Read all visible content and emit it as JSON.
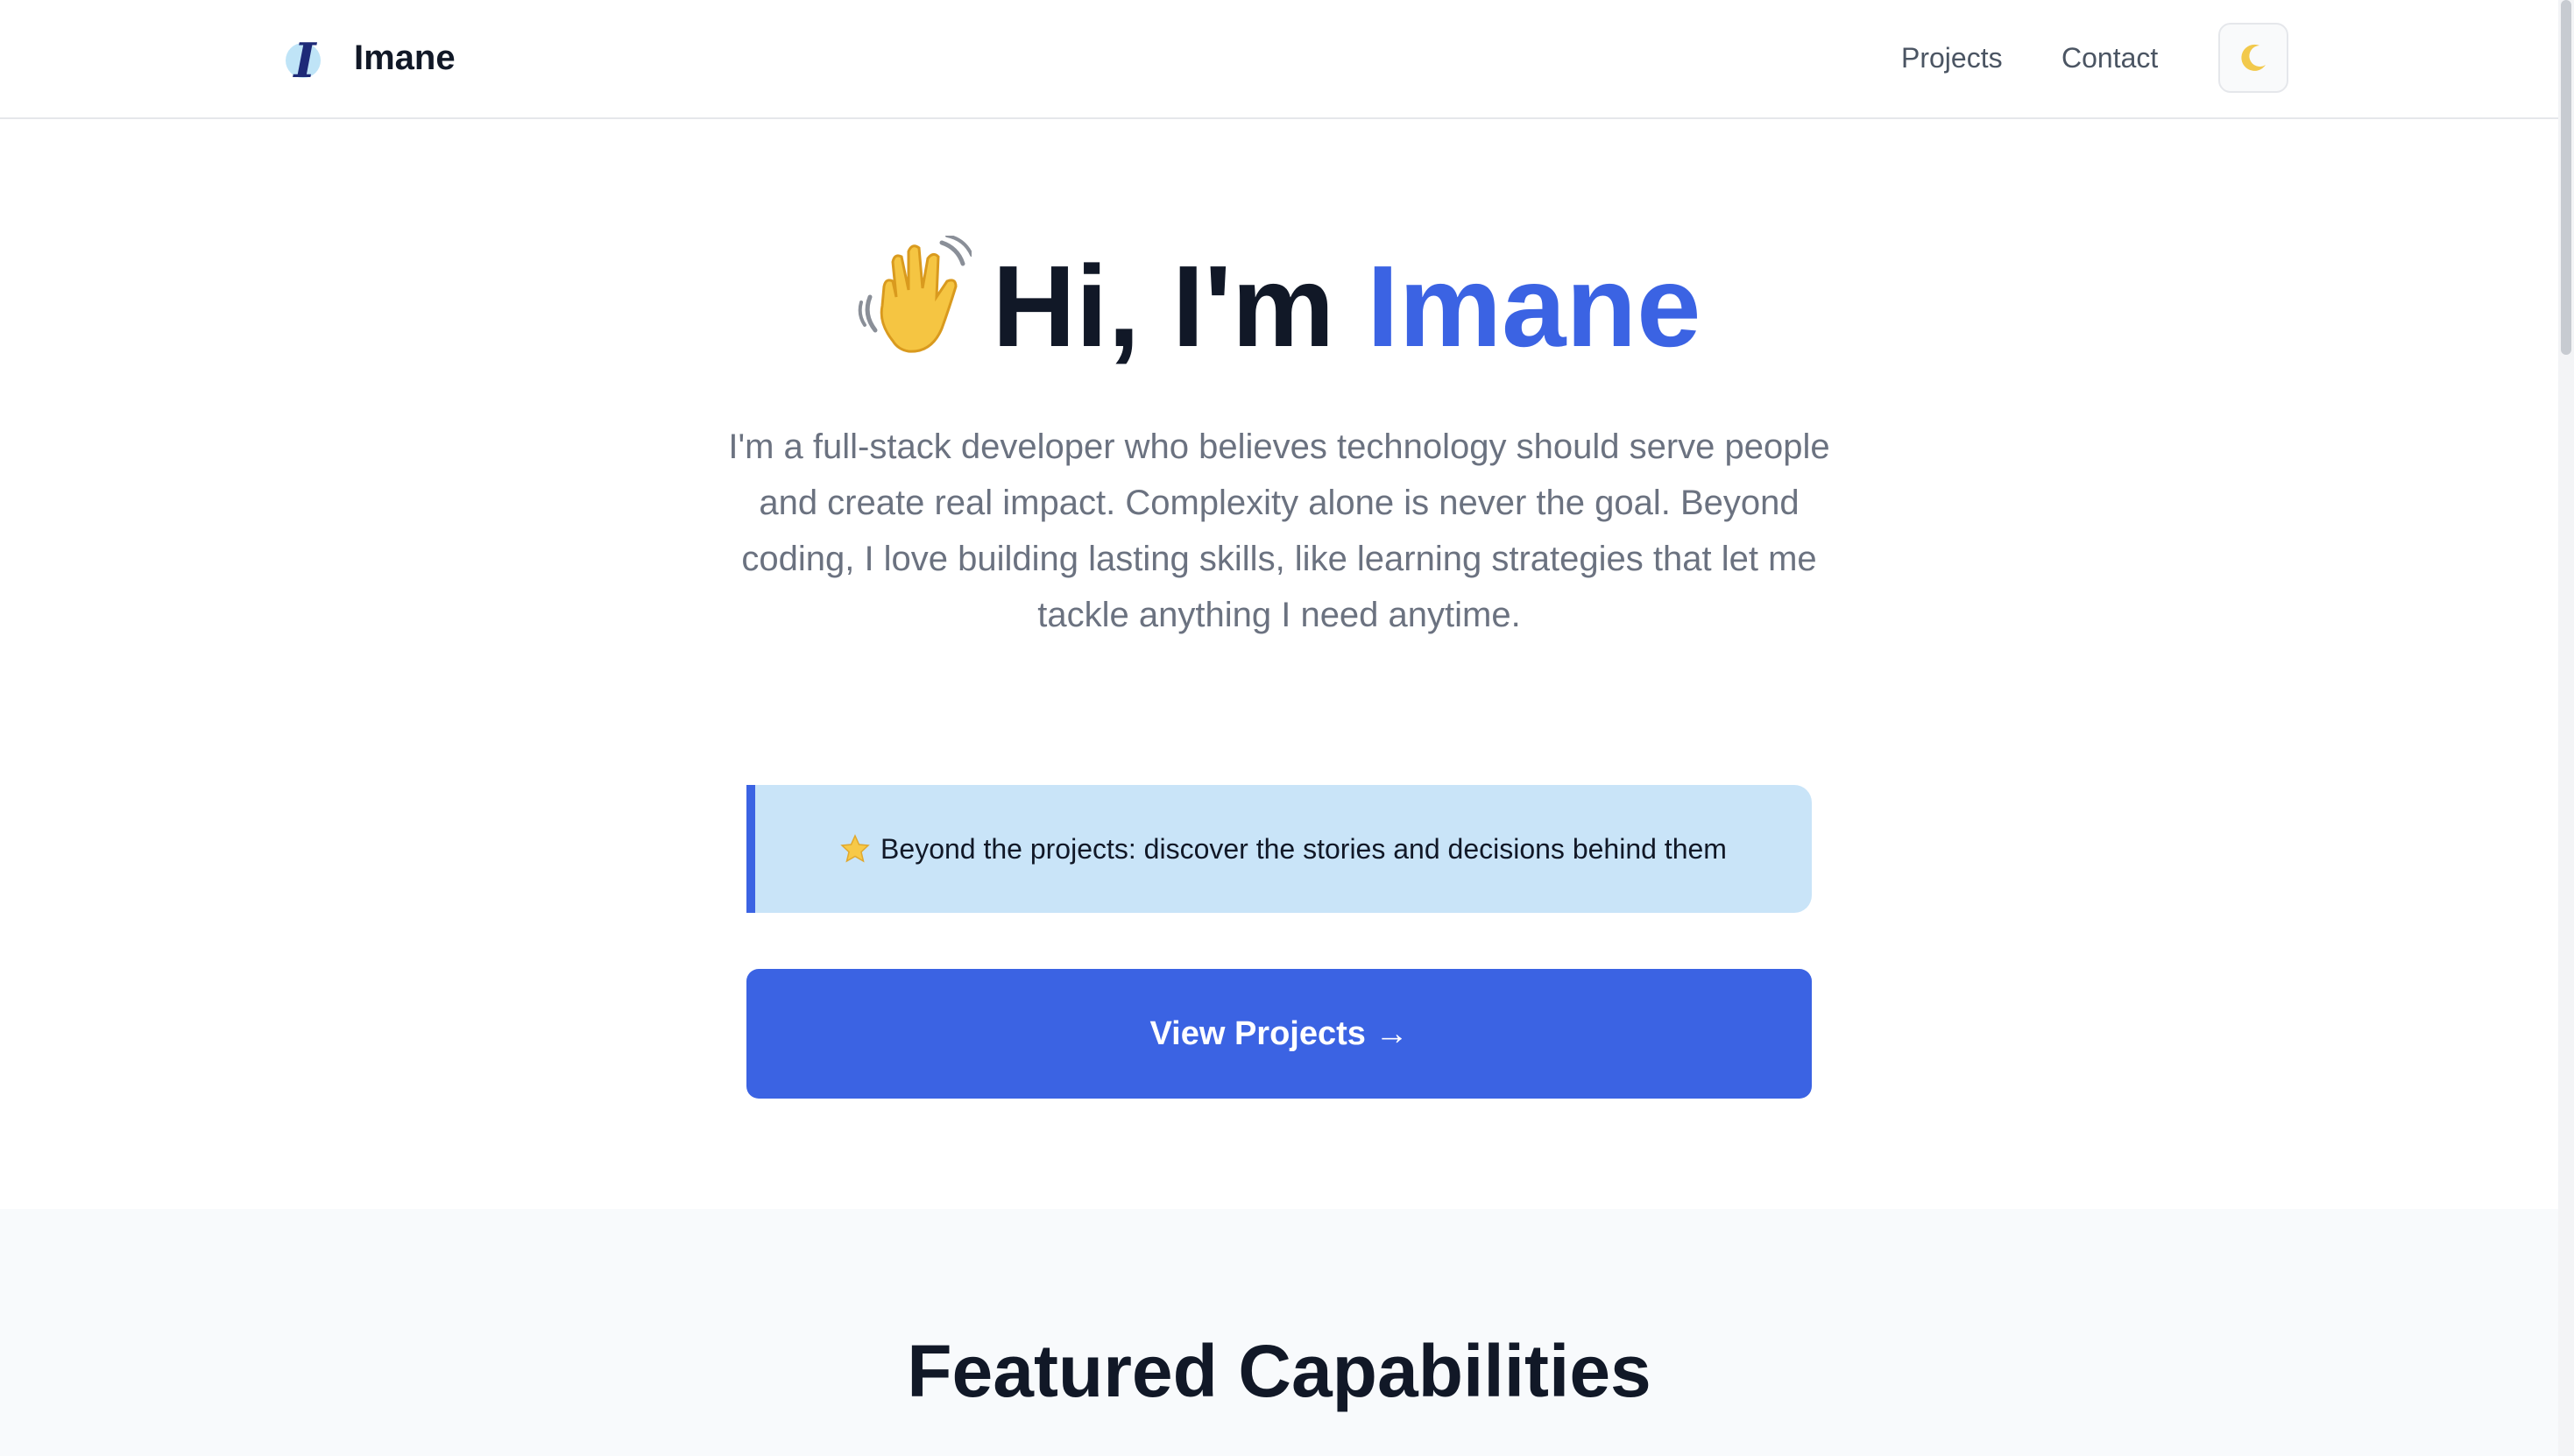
{
  "nav": {
    "brand": "Imane",
    "links": [
      {
        "label": "Projects"
      },
      {
        "label": "Contact"
      }
    ],
    "theme_toggle_icon": "moon-icon"
  },
  "hero": {
    "emoji_icon": "waving-hand-icon",
    "title_prefix": "Hi, I'm",
    "title_name": "Imane",
    "description": "I'm a full-stack developer who believes technology should serve people and create real impact. Complexity alone is never the goal. Beyond coding, I love building lasting skills, like learning strategies that let me tackle anything I need anytime."
  },
  "callout": {
    "icon": "star-icon",
    "text": "Beyond the projects: discover the stories and decisions behind them"
  },
  "cta": {
    "label": "View Projects →"
  },
  "featured": {
    "title": "Featured Capabilities"
  },
  "colors": {
    "accent": "#3b63e3",
    "callout_bg": "#c9e4f8",
    "text_dark": "#111827",
    "text_muted": "#6b7280"
  }
}
